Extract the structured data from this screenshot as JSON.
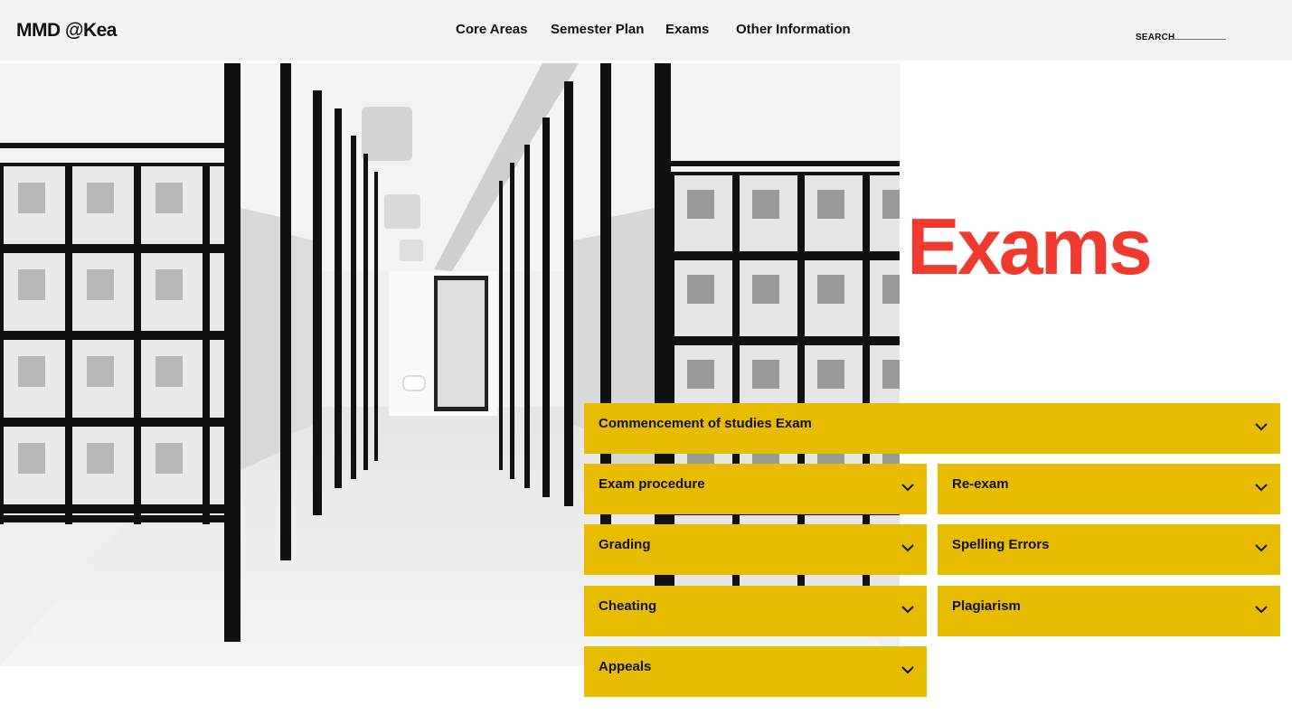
{
  "header": {
    "logo": "MMD @Kea",
    "nav": [
      "Core Areas",
      "Semester Plan",
      "Exams",
      "Other Information"
    ],
    "search_label": "SEARCH",
    "search_value": ""
  },
  "page": {
    "title": "Exams"
  },
  "accordion": [
    "Commencement of studies Exam",
    "Exam procedure",
    "Re-exam",
    "Grading",
    "Spelling Errors",
    "Cheating",
    "Plagiarism",
    "Appeals"
  ],
  "colors": {
    "accent_title": "#f03a30",
    "accordion_bg": "#e8bc00",
    "header_bg": "#f2f2f2"
  },
  "icons": {
    "accordion": "chevron-down-icon",
    "hero": "library-shelves-photo"
  }
}
